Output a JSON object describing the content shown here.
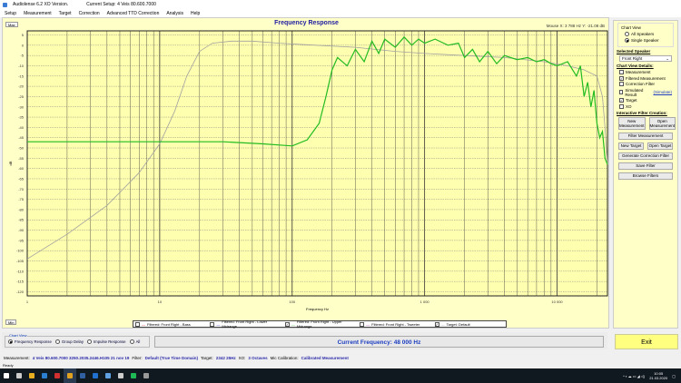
{
  "app": {
    "title": "Audiolense 6.2 XO Version.",
    "setup": "Current Setup: 4 Veis 80.600.7000"
  },
  "menu": [
    "Setup",
    "Measurement",
    "Target",
    "Correction",
    "Advanced TTD Correction",
    "Analysis",
    "Help"
  ],
  "chart": {
    "title": "Frequency Response",
    "mouse": "Mouse X: 3 788 Hz   Y: -21.08 dB",
    "max_label": "Max",
    "min_label": "Min",
    "xlabel": "Frequency Hz",
    "ylabel": "dB",
    "y_ticks": [
      5,
      0,
      -5,
      -10,
      -15,
      -20,
      -25,
      -30,
      -35,
      -40,
      -45,
      -50,
      -55,
      -60,
      -65,
      -70,
      -75,
      -80,
      -85,
      -90,
      -95,
      -100,
      -105,
      -110,
      -115,
      -120
    ],
    "x_ticks": [
      {
        "f": 1,
        "label": "1"
      },
      {
        "f": 10,
        "label": "10"
      },
      {
        "f": 100,
        "label": "100"
      },
      {
        "f": 1000,
        "label": "1 000"
      },
      {
        "f": 10000,
        "label": "10 000"
      }
    ],
    "colors": {
      "target": "#a0a0a0",
      "measurement": "#22bb22",
      "grid": "#444444"
    }
  },
  "chart_data": {
    "type": "line",
    "xlabel": "Frequency Hz",
    "ylabel": "dB",
    "xscale": "log",
    "xlim": [
      1,
      24000
    ],
    "ylim": [
      -122,
      7
    ],
    "series": [
      {
        "name": "Target: Default",
        "x": [
          1,
          2,
          4,
          7,
          10,
          13,
          16,
          20,
          25,
          35,
          50,
          80,
          150,
          300,
          600,
          1000,
          2000,
          4000,
          8000,
          12000,
          16000,
          20000,
          22000,
          23000,
          24000
        ],
        "y": [
          -104,
          -92,
          -78,
          -62,
          -48,
          -32,
          -15,
          -3,
          1,
          2,
          2,
          1,
          0,
          -1,
          -3,
          -4,
          -5,
          -6,
          -8,
          -10,
          -12,
          -15,
          -25,
          -40,
          -58
        ]
      },
      {
        "name": "Filtered: Front Right - Upper Midrange",
        "x": [
          1,
          10,
          30,
          60,
          100,
          130,
          160,
          180,
          200,
          220,
          260,
          300,
          350,
          400,
          450,
          500,
          600,
          700,
          800,
          900,
          1000,
          1200,
          1500,
          1800,
          2000,
          2300,
          2600,
          3000,
          3500,
          4000,
          5000,
          6000,
          7000,
          8000,
          9000,
          10000,
          12000,
          14000,
          15000,
          16000,
          17000,
          18000,
          19000,
          20000,
          21000,
          22000,
          23000,
          24000
        ],
        "y": [
          -47,
          -47,
          -47,
          -48,
          -49,
          -46,
          -38,
          -25,
          -12,
          -6,
          -10,
          -2,
          -8,
          2,
          -4,
          3,
          -1,
          4,
          0,
          3,
          1,
          3,
          0,
          1,
          -6,
          -2,
          -8,
          -3,
          -9,
          -5,
          -7,
          -6,
          -8,
          -7,
          -9,
          -10,
          -8,
          -15,
          -10,
          -25,
          -18,
          -30,
          -22,
          -38,
          -45,
          -42,
          -55,
          -58
        ]
      }
    ]
  },
  "legend": [
    {
      "label": "Filtered: Front Right - Bass",
      "checked": false,
      "color": "#cc0000"
    },
    {
      "label": "Filtered: Front Right - Lower Midrange",
      "checked": false,
      "color": "#0000cc"
    },
    {
      "label": "Filtered: Front Right - Upper Midrange",
      "checked": true,
      "color": "#22bb22"
    },
    {
      "label": "Filtered: Front Right - Tweeter",
      "checked": false,
      "color": "#aa00aa"
    },
    {
      "label": "Target: Default",
      "checked": true,
      "color": "#a0a0a0"
    }
  ],
  "side": {
    "chart_view": "Chart View",
    "all": "All Speakers",
    "single": "Single Speaker",
    "selected_speaker_h": "Selected Speaker",
    "speaker": "Front Right",
    "details_h": "Chart View Details:",
    "details": [
      {
        "label": "Measurement",
        "checked": false
      },
      {
        "label": "Filtered Measurement",
        "checked": true
      },
      {
        "label": "Correction Filter",
        "checked": false
      },
      {
        "label": "Simulated Result",
        "checked": false,
        "extra": "(Simulate)"
      },
      {
        "label": "Target",
        "checked": true
      },
      {
        "label": "XO",
        "checked": false
      }
    ],
    "ifc_h": "Interactive Filter Creation:",
    "new_meas": "New Measurement",
    "open_meas": "Open Measurement",
    "filter_meas": "Filter Measurement",
    "new_target": "New Target",
    "open_target": "Open Target",
    "gen": "Generate Correction Filter",
    "save": "Save Filter",
    "browse": "Browse Filters"
  },
  "bottom": {
    "chart_view": "Chart View",
    "views": [
      {
        "label": "Frequency Response",
        "on": true
      },
      {
        "label": "Group Delay",
        "on": false
      },
      {
        "label": "Impulse Response",
        "on": false
      },
      {
        "label": "All",
        "on": false
      }
    ],
    "current": "Current Frequency: 48 000 Hz",
    "exit": "Exit"
  },
  "status": {
    "meas_l": "Measurement:",
    "meas": "4 Veis 80.600.7000 3250.2035.2446.H105 21 nov 19",
    "filter_l": "Filter:",
    "filter": "Default (True Time Domain)",
    "target_l": "Target:",
    "target": "2342 25Hz",
    "xo_l": "XO:",
    "xo": "3 Octaves",
    "mic_l": "Mic Calibration:",
    "mic": "Calibrated Measurement",
    "ready": "Ready"
  },
  "taskbar": {
    "time": "10:05",
    "date": "21.03.2020",
    "icons": [
      "#ffffff",
      "#cccccc",
      "#e8b020",
      "#2a7fd0",
      "#d03030",
      "#e0a020",
      "#3060a0",
      "#2070d0",
      "#60a0e0",
      "#cccccc",
      "#1db954",
      "#999999"
    ]
  }
}
